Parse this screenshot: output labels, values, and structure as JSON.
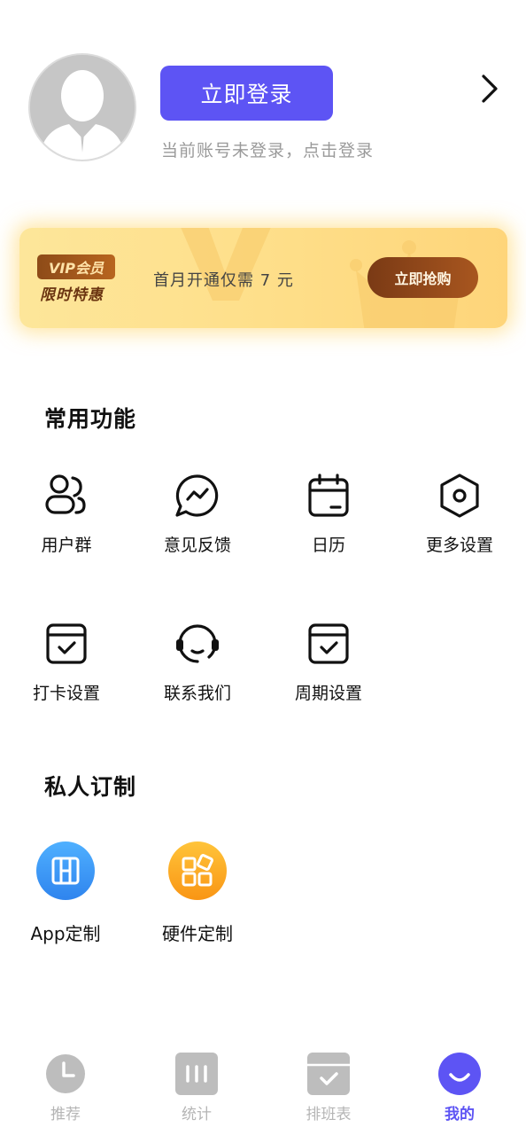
{
  "header": {
    "login_button": "立即登录",
    "login_hint": "当前账号未登录，点击登录"
  },
  "vip": {
    "tag": "VIP会员",
    "subtitle": "限时特惠",
    "offer": "首月开通仅需 7 元",
    "buy_button": "立即抢购"
  },
  "common": {
    "title": "常用功能",
    "items": [
      {
        "label": "用户群",
        "icon": "user-group-icon"
      },
      {
        "label": "意见反馈",
        "icon": "feedback-chat-icon"
      },
      {
        "label": "日历",
        "icon": "calendar-icon"
      },
      {
        "label": "更多设置",
        "icon": "hexagon-settings-icon"
      },
      {
        "label": "打卡设置",
        "icon": "checkin-calendar-icon"
      },
      {
        "label": "联系我们",
        "icon": "headset-icon"
      },
      {
        "label": "周期设置",
        "icon": "cycle-calendar-icon"
      }
    ]
  },
  "custom": {
    "title": "私人订制",
    "items": [
      {
        "label": "App定制",
        "icon": "app-custom-icon",
        "color": "#2f8df0"
      },
      {
        "label": "硬件定制",
        "icon": "hardware-custom-icon",
        "color": "#fba71b"
      }
    ]
  },
  "tabbar": {
    "items": [
      {
        "label": "推荐",
        "icon": "clock-icon",
        "active": false
      },
      {
        "label": "统计",
        "icon": "stats-icon",
        "active": false
      },
      {
        "label": "排班表",
        "icon": "schedule-icon",
        "active": false
      },
      {
        "label": "我的",
        "icon": "smile-icon",
        "active": true
      }
    ]
  },
  "colors": {
    "accent": "#5d54f4",
    "vip_gold": "#fedf8a",
    "vip_brown": "#8d4b18",
    "inactive": "#b5b5b5"
  }
}
